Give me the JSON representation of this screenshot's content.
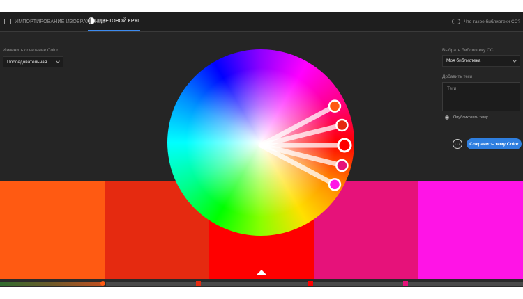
{
  "tabs": [
    {
      "label": "ИМПОРТИРОВАНИЕ ИЗОБРАЖЕНИЕ",
      "active": false,
      "icon": "image-icon"
    },
    {
      "label": "ЦВЕТОВОЙ КРУГ",
      "active": true,
      "icon": "color-wheel-icon"
    }
  ],
  "help_link": {
    "label": "Что такое библиотеки CC?",
    "icon": "cloud-icon"
  },
  "left_panel": {
    "rule_label": "Изменить сочетание Color",
    "rule_value": "Последовательная"
  },
  "right_panel": {
    "library_label": "Выбрать библиотеку CC",
    "library_value": "Моя библиотека",
    "tags_label": "Добавить теги",
    "tags_placeholder": "Теги",
    "publish_label": "Опубликовать тему",
    "more_label": "···",
    "save_label": "Сохранить тему Color"
  },
  "colors": {
    "accent": "#2f7fe0",
    "swatches": [
      "#ff5a12",
      "#e52a10",
      "#ff0000",
      "#e6127a",
      "#ff14e6"
    ]
  },
  "wheel": {
    "handle_angles_deg": [
      -28,
      -14,
      0,
      14,
      28
    ],
    "selected_index": 2
  }
}
